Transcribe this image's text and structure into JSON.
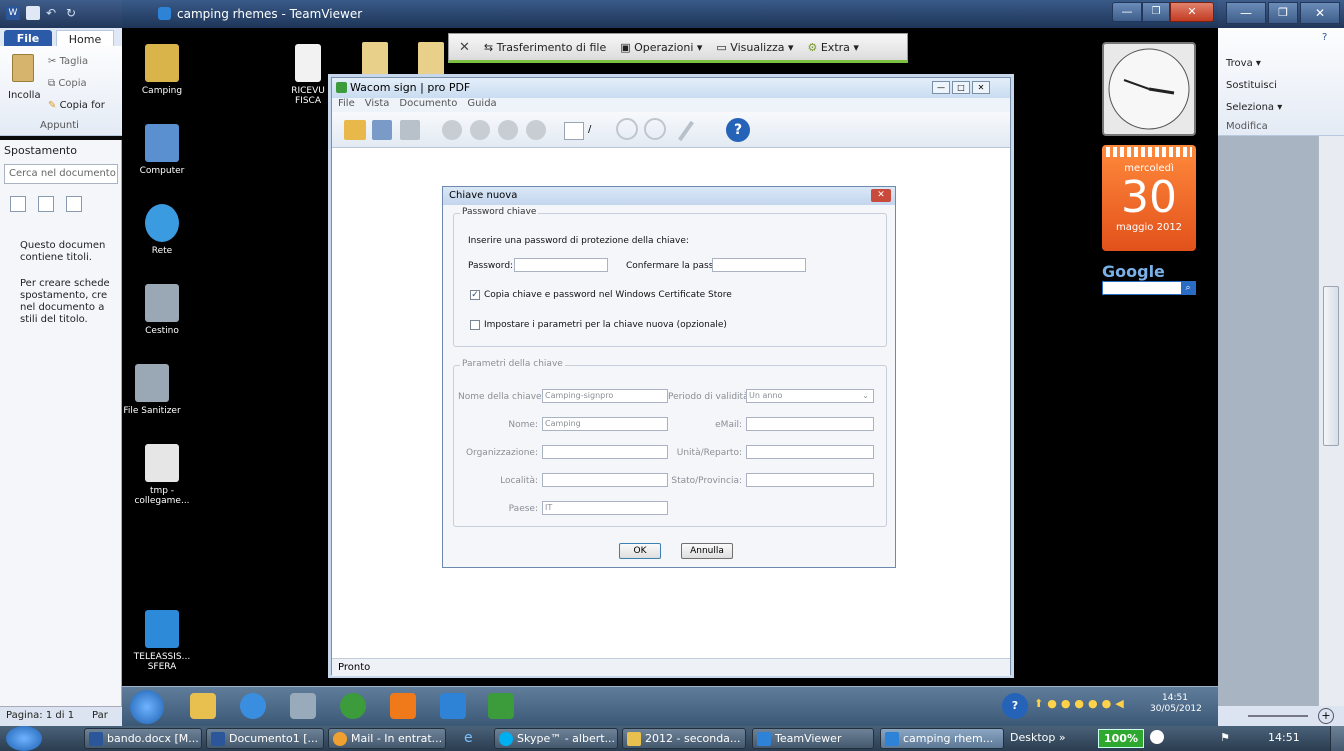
{
  "remote_window": {
    "title": "camping rhemes - TeamViewer"
  },
  "word": {
    "tabs": {
      "file": "File",
      "home": "Home"
    },
    "clipboard": {
      "cut": "Taglia",
      "copy": "Copia",
      "format_painter": "Copia for",
      "paste": "Incolla",
      "group": "Appunti"
    },
    "edit": {
      "find": "Trova ▾",
      "replace": "Sostituisci",
      "select": "Seleziona ▾",
      "group": "Modifica"
    },
    "nav": {
      "title": "Spostamento",
      "search_placeholder": "Cerca nel documento",
      "msg1": "Questo documen contiene titoli.",
      "msg2": "Per creare schede spostamento, cre nel documento a stili del titolo."
    },
    "status": {
      "page": "Pagina: 1 di 1",
      "words": "Par"
    }
  },
  "tv_toolbar": {
    "transfer": "Trasferimento di file",
    "actions": "Operazioni ▾",
    "view": "Visualizza ▾",
    "extra": "Extra ▾"
  },
  "desktop_icons": [
    {
      "label": "Camping",
      "color": "#d9b44a"
    },
    {
      "label": "Computer",
      "color": "#5a8fd0"
    },
    {
      "label": "Rete",
      "color": "#3a9be0"
    },
    {
      "label": "Cestino",
      "color": "#9aa7b4"
    },
    {
      "label": "File Sanitizer",
      "color": "#9aa7b4"
    },
    {
      "label": "tmp - collegame...",
      "color": "#e6e6e6"
    },
    {
      "label": "TELEASSIS... SFERA",
      "color": "#2d8ad9"
    },
    {
      "label": "RICEVU FISCA",
      "color": "#f2f2f2"
    }
  ],
  "wacom": {
    "title": "Wacom sign | pro PDF",
    "menu": [
      "File",
      "Vista",
      "Documento",
      "Guida"
    ],
    "page_sep": "/",
    "status": "Pronto"
  },
  "dialog": {
    "title": "Chiave nuova",
    "group_password": "Password chiave",
    "instruction": "Inserire una password di protezione della chiave:",
    "password_label": "Password:",
    "confirm_label": "Confermare la password:",
    "copy_checkbox": "Copia chiave e password nel Windows Certificate Store",
    "params_checkbox": "Impostare i parametri per la chiave nuova (opzionale)",
    "group_params": "Parametri della chiave",
    "key_name_label": "Nome della chiave:",
    "key_name_value": "Camping-signpro",
    "validity_label": "Periodo di validità:",
    "validity_value": "Un anno",
    "name_label": "Nome:",
    "name_value": "Camping",
    "email_label": "eMail:",
    "org_label": "Organizzazione:",
    "unit_label": "Unità/Reparto:",
    "city_label": "Località:",
    "state_label": "Stato/Provincia:",
    "country_label": "Paese:",
    "country_value": "IT",
    "ok": "OK",
    "cancel": "Annulla"
  },
  "calendar": {
    "weekday": "mercoledì",
    "day": "30",
    "month_year": "maggio 2012"
  },
  "google_gadget": {
    "logo": "Google"
  },
  "remote_tray": {
    "time": "14:51",
    "date": "30/05/2012"
  },
  "local_taskbar": {
    "buttons": [
      {
        "label": "bando.docx [M...",
        "color": "#2b579a"
      },
      {
        "label": "Documento1 [...",
        "color": "#2b579a"
      },
      {
        "label": "Mail - In entrat...",
        "color": "#f0a030"
      },
      {
        "label": "Skype™ - albert...",
        "color": "#00aff0"
      },
      {
        "label": "2012 - seconda...",
        "color": "#e8c050"
      },
      {
        "label": "TeamViewer",
        "color": "#2f83d6"
      },
      {
        "label": "camping rhem...",
        "color": "#2f83d6"
      }
    ],
    "desktop": "Desktop »",
    "battery": "100%",
    "time": "14:51"
  }
}
